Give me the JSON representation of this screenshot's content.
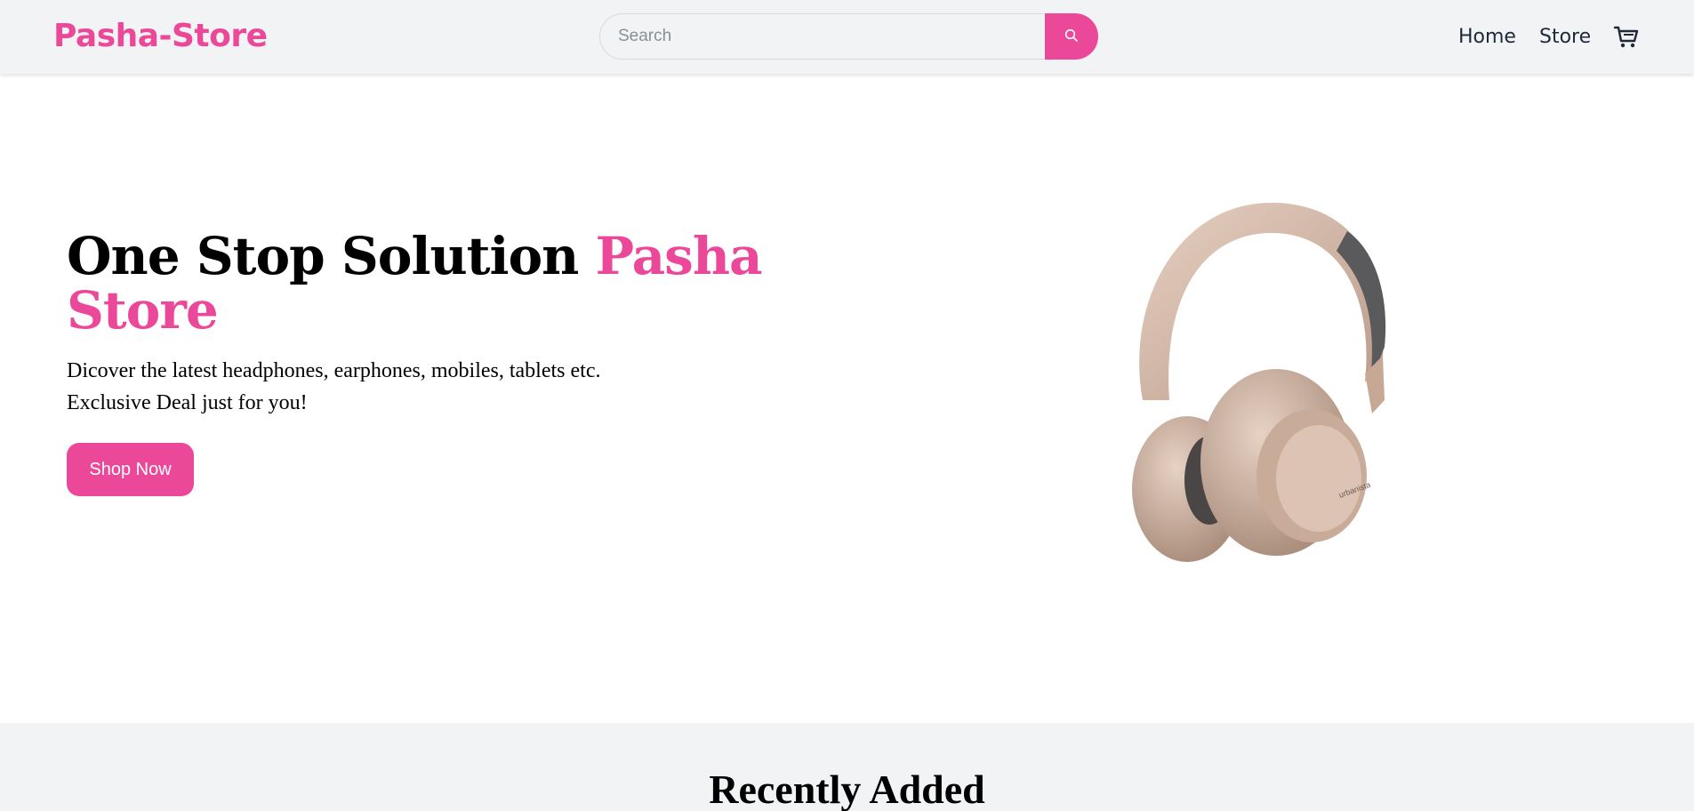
{
  "header": {
    "brand": "Pasha-Store",
    "search": {
      "placeholder": "Search",
      "value": "",
      "button_icon": "search-icon"
    },
    "nav": [
      {
        "label": "Home"
      },
      {
        "label": "Store"
      }
    ],
    "cart_icon": "cart-icon"
  },
  "hero": {
    "title_main": "One Stop Solution ",
    "title_accent": "Pasha Store",
    "subtitle_line1": "Dicover the latest headphones, earphones, mobiles, tablets etc.",
    "subtitle_line2": "Exclusive Deal just for you!",
    "cta_label": "Shop Now",
    "image_icon": "headphones-image"
  },
  "recent": {
    "title": "Recently Added"
  },
  "colors": {
    "accent": "#ec4899",
    "header_bg": "#f1f3f5",
    "text": "#000000"
  }
}
